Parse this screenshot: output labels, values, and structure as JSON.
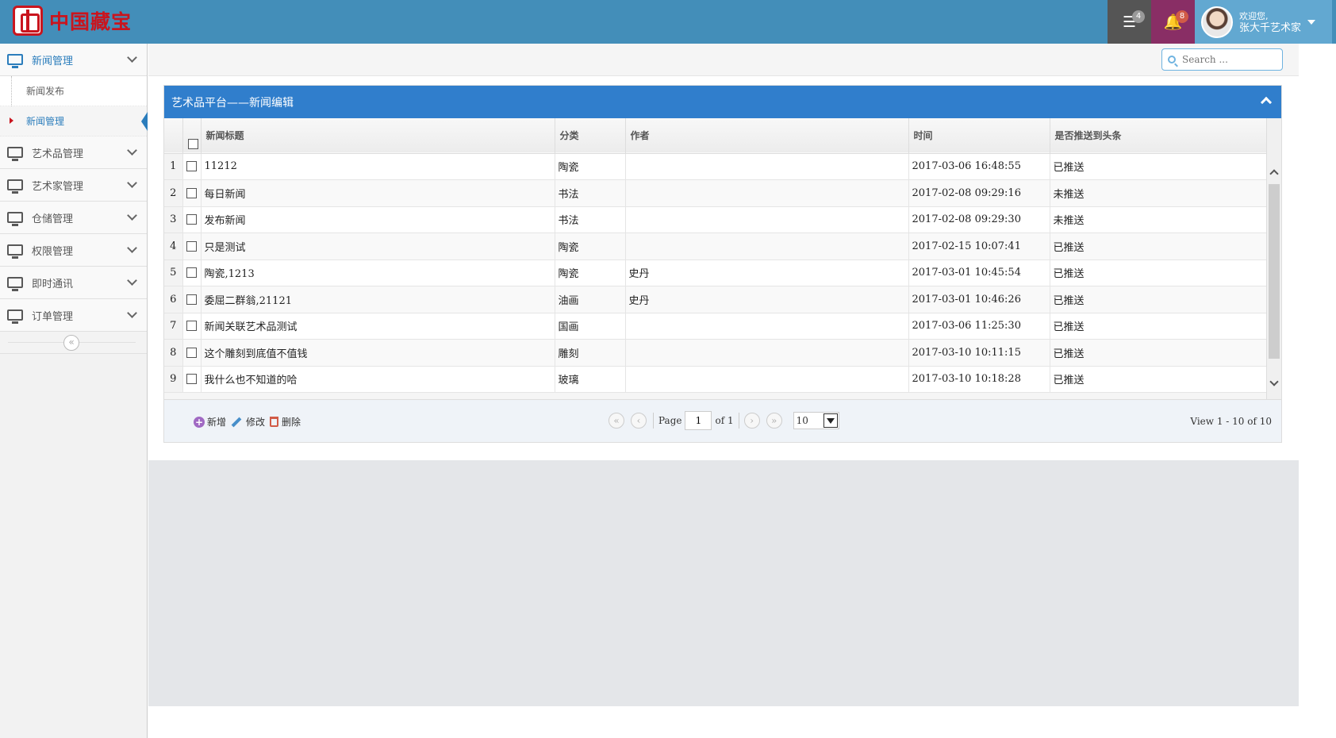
{
  "header": {
    "logo_text": "中国藏宝",
    "tasks_count": "4",
    "notify_count": "8",
    "user_welcome": "欢迎您,",
    "user_name": "张大千艺术家"
  },
  "sidebar": {
    "items": [
      {
        "label": "新闻管理"
      },
      {
        "label": "艺术品管理"
      },
      {
        "label": "艺术家管理"
      },
      {
        "label": "仓储管理"
      },
      {
        "label": "权限管理"
      },
      {
        "label": "即时通讯"
      },
      {
        "label": "订单管理"
      }
    ],
    "submenu": [
      {
        "label": "新闻发布"
      },
      {
        "label": "新闻管理"
      }
    ],
    "collapse_glyph": "«"
  },
  "search": {
    "placeholder": "Search ..."
  },
  "grid": {
    "caption": "艺术品平台——新闻编辑",
    "columns": [
      "新闻标题",
      "分类",
      "作者",
      "时间",
      "是否推送到头条"
    ],
    "rows": [
      {
        "n": "1",
        "title": "11212",
        "cat": "陶瓷",
        "author": "",
        "time": "2017-03-06 16:48:55",
        "push": "已推送"
      },
      {
        "n": "2",
        "title": "每日新闻",
        "cat": "书法",
        "author": "",
        "time": "2017-02-08 09:29:16",
        "push": "未推送"
      },
      {
        "n": "3",
        "title": "发布新闻",
        "cat": "书法",
        "author": "",
        "time": "2017-02-08 09:29:30",
        "push": "未推送"
      },
      {
        "n": "4",
        "title": "只是测试",
        "cat": "陶瓷",
        "author": "",
        "time": "2017-02-15 10:07:41",
        "push": "已推送"
      },
      {
        "n": "5",
        "title": "陶瓷,1213",
        "cat": "陶瓷",
        "author": "史丹",
        "time": "2017-03-01 10:45:54",
        "push": "已推送"
      },
      {
        "n": "6",
        "title": "委屈二群翁,21121",
        "cat": "油画",
        "author": "史丹",
        "time": "2017-03-01 10:46:26",
        "push": "已推送"
      },
      {
        "n": "7",
        "title": "新闻关联艺术品测试",
        "cat": "国画",
        "author": "",
        "time": "2017-03-06 11:25:30",
        "push": "已推送"
      },
      {
        "n": "8",
        "title": "这个雕刻到底值不值钱",
        "cat": "雕刻",
        "author": "",
        "time": "2017-03-10 10:11:15",
        "push": "已推送"
      },
      {
        "n": "9",
        "title": "我什么也不知道的哈",
        "cat": "玻璃",
        "author": "",
        "time": "2017-03-10 10:18:28",
        "push": "已推送"
      }
    ]
  },
  "pager": {
    "add_label": "新增",
    "edit_label": "修改",
    "delete_label": "删除",
    "page_label": "Page",
    "page_value": "1",
    "of_label": "of 1",
    "rows_per_page": "10",
    "view_info": "View 1 - 10 of 10"
  }
}
